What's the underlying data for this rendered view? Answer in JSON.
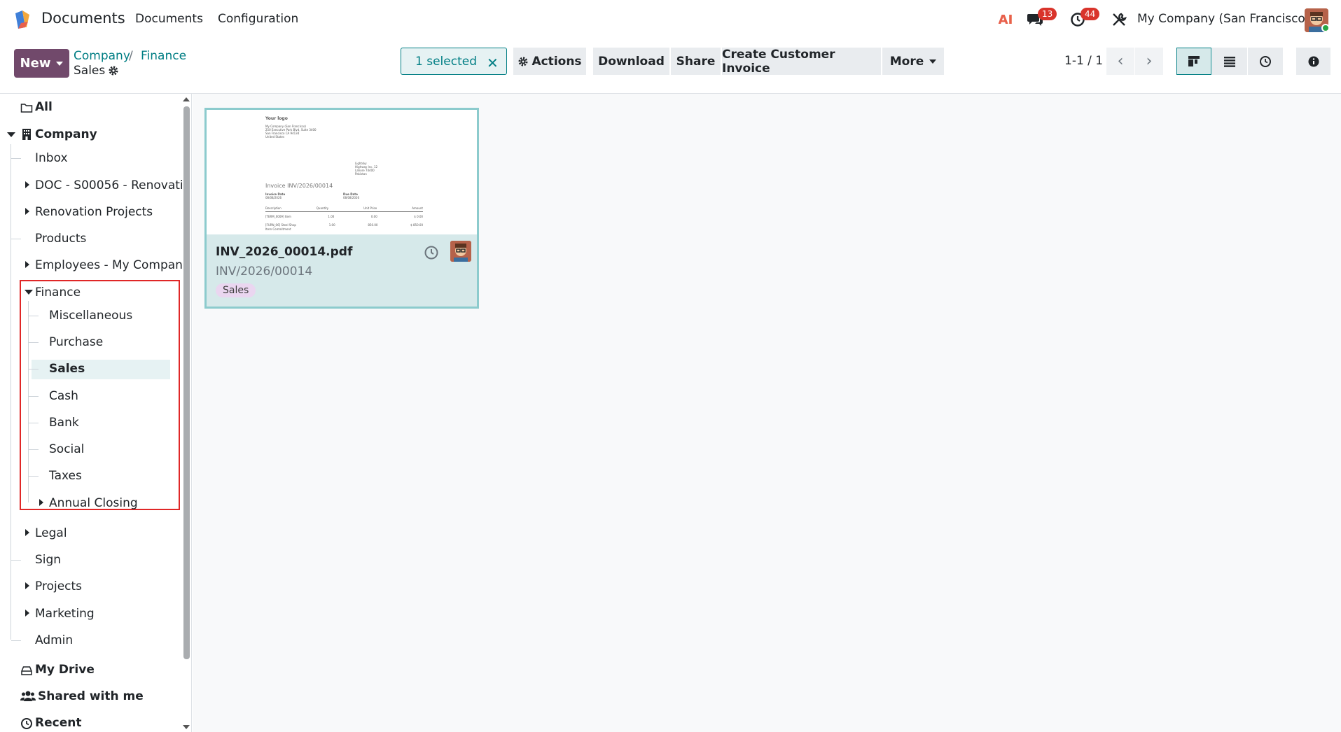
{
  "app": {
    "title": "Documents"
  },
  "nav": {
    "items": [
      "Documents",
      "Configuration"
    ]
  },
  "systray": {
    "ai_label": "AI",
    "messages_count": "13",
    "activities_count": "44",
    "company": "My Company (San Francisco)"
  },
  "control": {
    "new_label": "New",
    "breadcrumb": {
      "root": "Company",
      "sep": "/",
      "parent": "Finance",
      "current": "Sales"
    },
    "selection": "1 selected",
    "actions_label": "Actions",
    "buttons": [
      "Download",
      "Share",
      "Create Customer Invoice",
      "More"
    ],
    "pager": "1-1 / 1"
  },
  "sidebar": {
    "all": "All",
    "company": "Company",
    "items": [
      "Inbox",
      "DOC - S00056 - Renovati",
      "Renovation Projects",
      "Products",
      "Employees - My Compan"
    ],
    "finance": "Finance",
    "finance_children": [
      "Miscellaneous",
      "Purchase",
      "Sales",
      "Cash",
      "Bank",
      "Social",
      "Taxes",
      "Annual Closing"
    ],
    "after": [
      "Legal",
      "Sign",
      "Projects",
      "Marketing",
      "Admin"
    ],
    "my_drive": "My Drive",
    "shared": "Shared with me",
    "recent": "Recent"
  },
  "card": {
    "name": "INV_2026_00014.pdf",
    "ref": "INV/2026/00014",
    "tag": "Sales",
    "preview": {
      "logo": "Your logo",
      "address": [
        "My Company (San Francisco)",
        "250 Executive Park Blvd, Suite 3400",
        "San Francisco CA 94134",
        "United States"
      ],
      "customer": [
        "Lightsky",
        "Highway Inc. 12",
        "Lahore 74400",
        "Pakistan"
      ],
      "invoice_title": "Invoice INV/2026/00014",
      "invoice_date_label": "Invoice Date",
      "invoice_date": "08/08/2026",
      "due_date_label": "Due Date",
      "due_date": "08/08/2026",
      "columns": [
        "Description",
        "Quantity",
        "Unit Price",
        "Amount"
      ],
      "rows": [
        [
          "[TERM_0009] Item",
          "1.00",
          "0.00",
          "$ 0.00"
        ],
        [
          "[FURN_06] Steel Shop",
          "1.00",
          "850.00",
          "$ 850.00"
        ]
      ],
      "footer": "Item Commitment"
    }
  }
}
